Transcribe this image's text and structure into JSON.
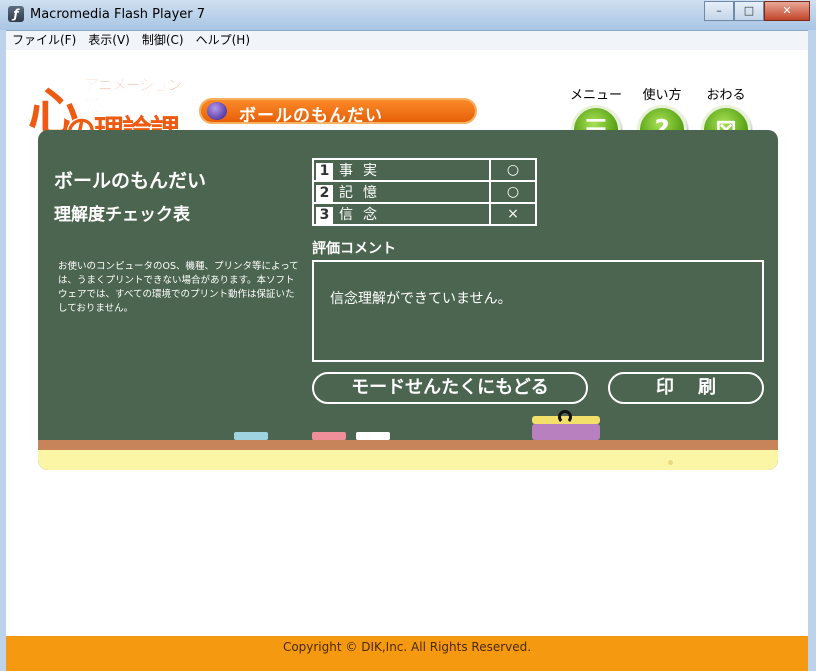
{
  "window": {
    "title": "Macromedia Flash Player 7",
    "icon_glyph": "ƒ",
    "controls": {
      "minimize": "–",
      "maximize": "□",
      "close": "✕"
    }
  },
  "menubar": {
    "items": [
      "ファイル(F)",
      "表示(V)",
      "制御(C)",
      "ヘルプ(H)"
    ]
  },
  "logo": {
    "sub": "アニメーション版",
    "big": "心",
    "main": "の理論課題"
  },
  "header": {
    "title": "ボールのもんだい"
  },
  "nav": {
    "menu": {
      "label": "メニュー",
      "glyph": "☰",
      "icon": "menu-icon"
    },
    "howto": {
      "label": "使い方",
      "glyph": "?",
      "icon": "question-icon"
    },
    "exit": {
      "label": "おわる",
      "glyph": "⊠",
      "icon": "exit-icon"
    }
  },
  "board": {
    "title": "ボールのもんだい",
    "subtitle": "理解度チェック表",
    "note": "お使いのコンピュータのOS、機種、プリンタ等によっては、うまくプリントできない場合があります。本ソフトウェアでは、すべての環境でのプリント動作は保証いたしておりません。",
    "checks": [
      {
        "num": "1",
        "label": "事実",
        "mark": "○"
      },
      {
        "num": "2",
        "label": "記憶",
        "mark": "○"
      },
      {
        "num": "3",
        "label": "信念",
        "mark": "×"
      }
    ],
    "comment_label": "評価コメント",
    "comment_text": "信念理解ができていません。",
    "back_button": "モードせんたくにもどる",
    "print_button": "印刷"
  },
  "colors": {
    "board": "#4b6550",
    "accent_orange": "#ef5a13",
    "nav_green": "#4c9a0c",
    "footer": "#f59a10"
  },
  "footer": {
    "copyright": "Copyright © DIK,Inc. All Rights Reserved."
  }
}
